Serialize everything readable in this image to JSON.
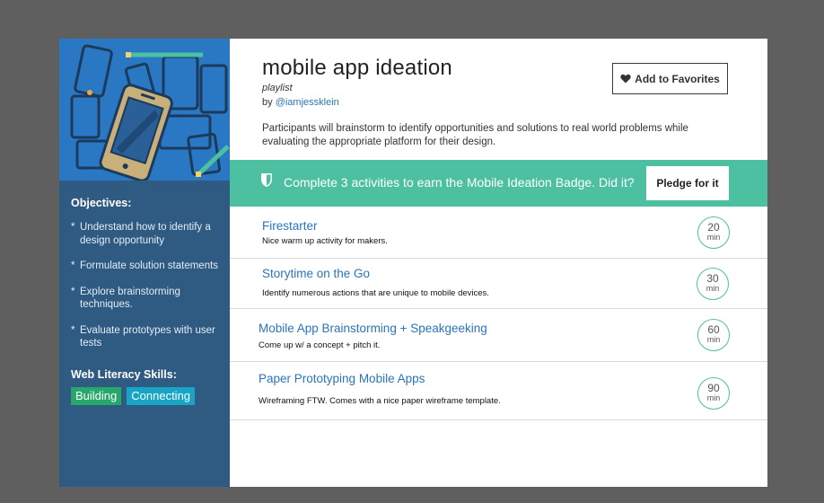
{
  "colors": {
    "background": "#5f5f5f",
    "sidebar": "#2f5b82",
    "hero": "#2a78c4",
    "accent": "#4cc0a0",
    "link": "#2b74b8",
    "skill_building": "#27a86a",
    "skill_connecting": "#18a4c4"
  },
  "sidebar": {
    "objectives_title": "Objectives:",
    "objectives": [
      "Understand how to identify a design opportunity",
      "Formulate solution statements",
      "Explore brainstorming techniques.",
      "Evaluate prototypes with user tests"
    ],
    "bullet": "*",
    "skills_title": "Web Literacy Skills:",
    "skills": [
      "Building",
      "Connecting"
    ]
  },
  "header": {
    "title": "mobile app ideation",
    "subtitle": "playlist",
    "by_prefix": "by",
    "author": "@iamjessklein",
    "favorite_icon": "heart-icon",
    "favorite_label": "Add to Favorites"
  },
  "description": "Participants will brainstorm to identify opportunities and solutions to real world problems while evaluating the appropriate platform for their design.",
  "badge": {
    "icon": "shield-icon",
    "text": "Complete 3 activities to earn the Mobile Ideation Badge. Did it?",
    "pledge_label": "Pledge for it"
  },
  "activities": [
    {
      "title": "Firestarter",
      "description": "Nice warm up activity for makers.",
      "duration": "20",
      "unit": "min"
    },
    {
      "title": "Storytime on the Go",
      "description": "Identify numerous actions that are unique to mobile devices.",
      "duration": "30",
      "unit": "min"
    },
    {
      "title": "Mobile App Brainstorming + Speakgeeking",
      "description": "Come up w/ a concept + pitch it.",
      "duration": "60",
      "unit": "min"
    },
    {
      "title": "Paper Prototyping Mobile Apps",
      "description": "Wireframing FTW. Comes with a nice paper wireframe template.",
      "duration": "90",
      "unit": "min"
    }
  ]
}
